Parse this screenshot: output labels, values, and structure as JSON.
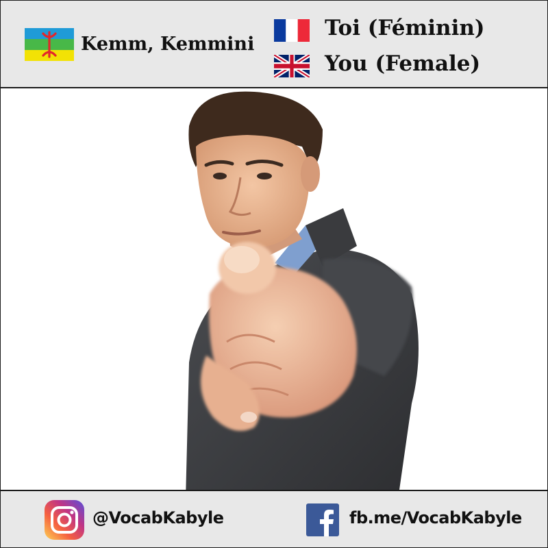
{
  "header": {
    "kabyle": {
      "flag_icon": "amazigh-flag-icon",
      "word": "Kemm, Kemmini"
    },
    "french": {
      "flag_icon": "france-flag-icon",
      "word": "Toi (Féminin)"
    },
    "english": {
      "flag_icon": "uk-flag-icon",
      "word": "You (Female)"
    }
  },
  "photo": {
    "icon": "man-pointing-at-viewer-photo"
  },
  "footer": {
    "instagram": {
      "icon": "instagram-icon",
      "handle": "@VocabKabyle"
    },
    "facebook": {
      "icon": "facebook-icon",
      "link": "fb.me/VocabKabyle"
    }
  },
  "colors": {
    "header_bg": "#e8e8e8",
    "border": "#1a1a1a",
    "facebook_blue": "#3b5998",
    "amazigh_blue": "#1f9bd7",
    "amazigh_green": "#48b848",
    "amazigh_yellow": "#f2e205",
    "amazigh_red": "#e3262b"
  }
}
